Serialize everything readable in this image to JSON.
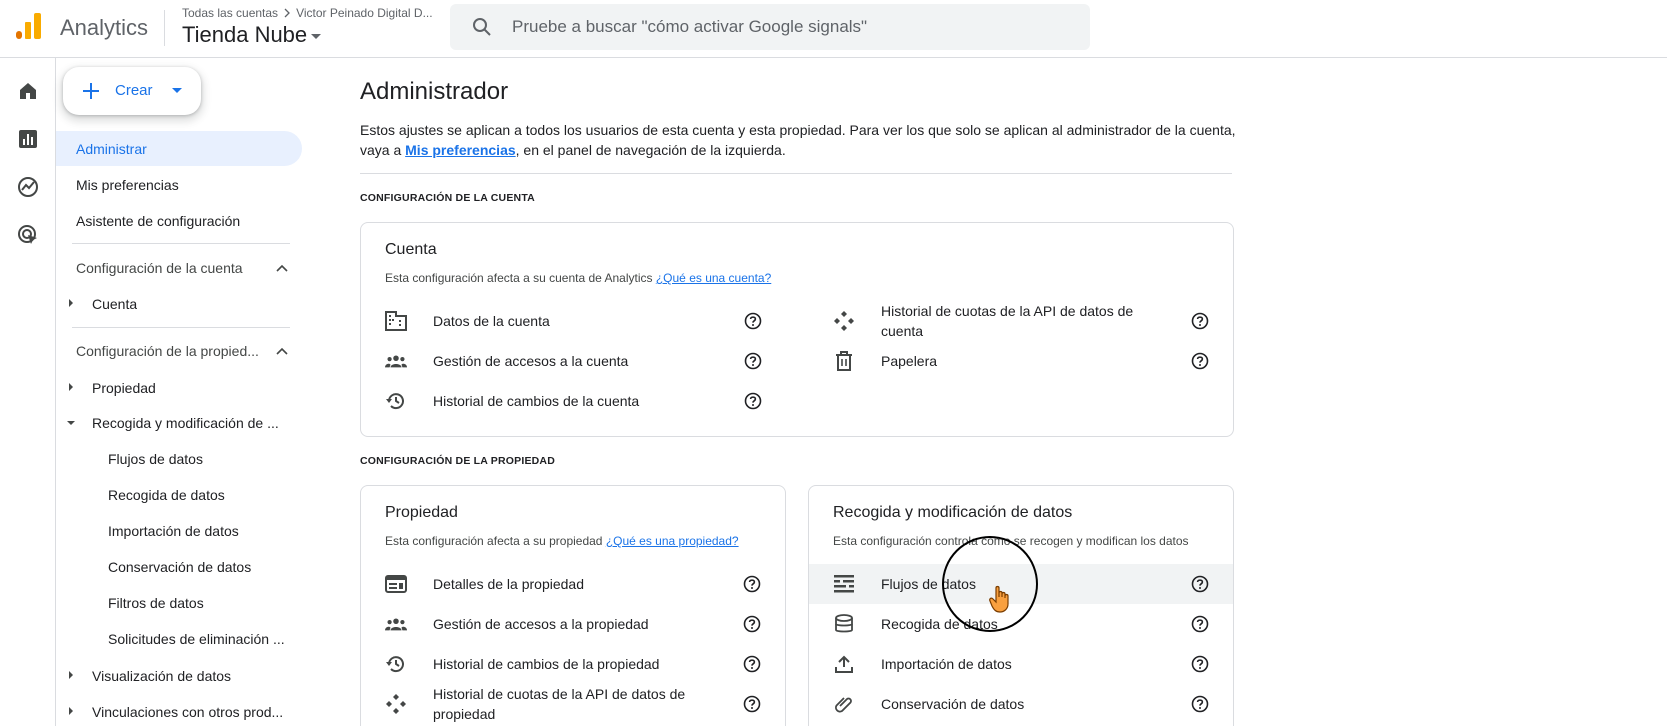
{
  "header": {
    "app_name": "Analytics",
    "breadcrumb_all": "Todas las cuentas",
    "breadcrumb_account": "Victor Peinado Digital D...",
    "property_name": "Tienda Nube",
    "search_placeholder": "Pruebe a buscar \"cómo activar Google signals\""
  },
  "create": {
    "label": "Crear"
  },
  "nav": {
    "administrar": "Administrar",
    "mis_preferencias": "Mis preferencias",
    "asistente": "Asistente de configuración",
    "config_cuenta": "Configuración de la cuenta",
    "cuenta": "Cuenta",
    "config_propiedad": "Configuración de la propied...",
    "propiedad": "Propiedad",
    "recogida_modificacion": "Recogida y modificación de ...",
    "sub_items": [
      "Flujos de datos",
      "Recogida de datos",
      "Importación de datos",
      "Conservación de datos",
      "Filtros de datos",
      "Solicitudes de eliminación ..."
    ],
    "visualizacion": "Visualización de datos",
    "vinculaciones": "Vinculaciones con otros prod..."
  },
  "main": {
    "title": "Administrador",
    "desc_part1": "Estos ajustes se aplican a todos los usuarios de esta cuenta y esta propiedad. Para ver los que solo se aplican al administrador de la cuenta, vaya a ",
    "desc_link": "Mis preferencias",
    "desc_part2": ", en el panel de navegación de la izquierda.",
    "sec_cuenta": "CONFIGURACIÓN DE LA CUENTA",
    "sec_propiedad": "CONFIGURACIÓN DE LA PROPIEDAD"
  },
  "card_cuenta": {
    "title": "Cuenta",
    "sub": "Esta configuración afecta a su cuenta de Analytics ",
    "sub_link": "¿Qué es una cuenta?",
    "left": [
      "Datos de la cuenta",
      "Gestión de accesos a la cuenta",
      "Historial de cambios de la cuenta"
    ],
    "right": [
      "Historial de cuotas de la API de datos de cuenta",
      "Papelera"
    ]
  },
  "card_propiedad": {
    "title": "Propiedad",
    "sub": "Esta configuración afecta a su propiedad ",
    "sub_link": "¿Qué es una propiedad?",
    "items": [
      "Detalles de la propiedad",
      "Gestión de accesos a la propiedad",
      "Historial de cambios de la propiedad",
      "Historial de cuotas de la API de datos de propiedad"
    ]
  },
  "card_recogida": {
    "title": "Recogida y modificación de datos",
    "sub": "Esta configuración controla cómo se recogen y modifican los datos",
    "items": [
      "Flujos de datos",
      "Recogida de datos",
      "Importación de datos",
      "Conservación de datos"
    ]
  },
  "colors": {
    "accent": "#1a73e8",
    "active_bg": "#e8f0fe",
    "logo_orange": "#f9ab00",
    "logo_dark": "#e37400"
  }
}
